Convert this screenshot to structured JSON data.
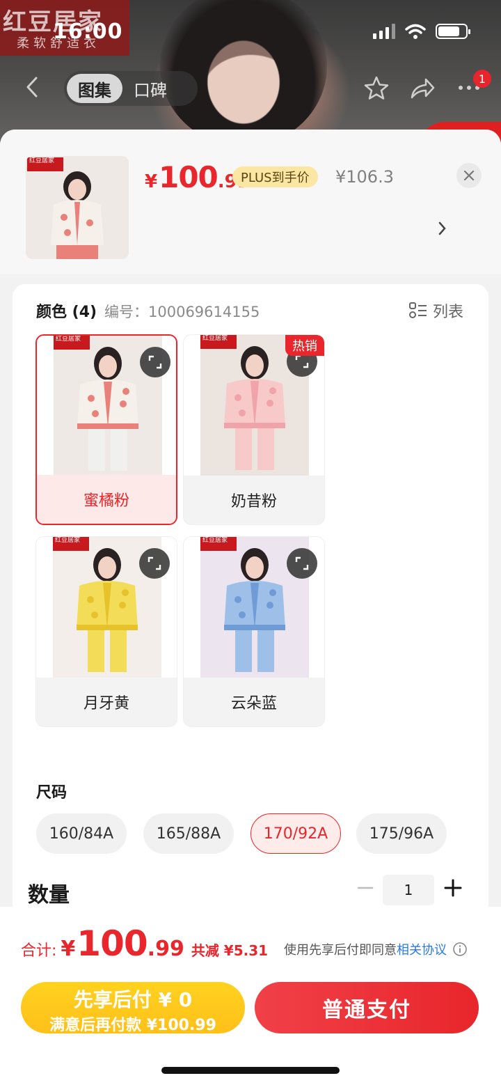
{
  "status_bar": {
    "time": "16:00"
  },
  "background": {
    "brand_line1": "红豆居家",
    "brand_line2": "柔软舒适衣"
  },
  "nav": {
    "tabs": [
      {
        "label": "图集",
        "active": true
      },
      {
        "label": "口碑",
        "active": false
      }
    ],
    "badge_count": "1",
    "icons": [
      "back-icon",
      "star-icon",
      "share-icon",
      "more-icon"
    ]
  },
  "product": {
    "price_currency": "¥",
    "price_int": "100",
    "price_dec": ".99",
    "plus_label": "PLUS到手价",
    "original_price": "¥106.3",
    "thumb_brand": "红豆居家"
  },
  "colors": {
    "title": "颜色 (4)",
    "sku": "编号：100069614155",
    "list_label": "列表",
    "options": [
      {
        "name": "蜜橘粉",
        "selected": true,
        "hot": "",
        "main": "#f0f0ee",
        "accent": "#e9817a",
        "bg": "#efe9e6"
      },
      {
        "name": "奶昔粉",
        "selected": false,
        "hot": "热销",
        "main": "#f7c9c9",
        "accent": "#f0a3a8",
        "bg": "#ece4df"
      },
      {
        "name": "月牙黄",
        "selected": false,
        "hot": "",
        "main": "#f2dc58",
        "accent": "#e8c22a",
        "bg": "#f3eeea"
      },
      {
        "name": "云朵蓝",
        "selected": false,
        "hot": "",
        "main": "#9dbfe8",
        "accent": "#6f9bd6",
        "bg": "#ece5f0"
      }
    ],
    "brand_mini": "红豆居家"
  },
  "sizes": {
    "title": "尺码",
    "options": [
      {
        "label": "160/84A",
        "selected": false
      },
      {
        "label": "165/88A",
        "selected": false
      },
      {
        "label": "170/92A",
        "selected": true
      },
      {
        "label": "175/96A",
        "selected": false
      }
    ]
  },
  "quantity": {
    "title": "数量",
    "value": "1"
  },
  "footer": {
    "total_label": "合计:",
    "total_currency": "¥",
    "total_int": "100",
    "total_dec": ".99",
    "saving": "共减 ¥5.31",
    "agree_text": "使用先享后付即同意",
    "agree_link": "相关协议",
    "later_line1": "先享后付 ¥ 0",
    "later_line2": "满意后再付款 ¥100.99",
    "pay_label": "普通支付"
  },
  "theme": {
    "accent": "#e8262b",
    "yellow": "#ffc81c",
    "link": "#2a7be4"
  }
}
